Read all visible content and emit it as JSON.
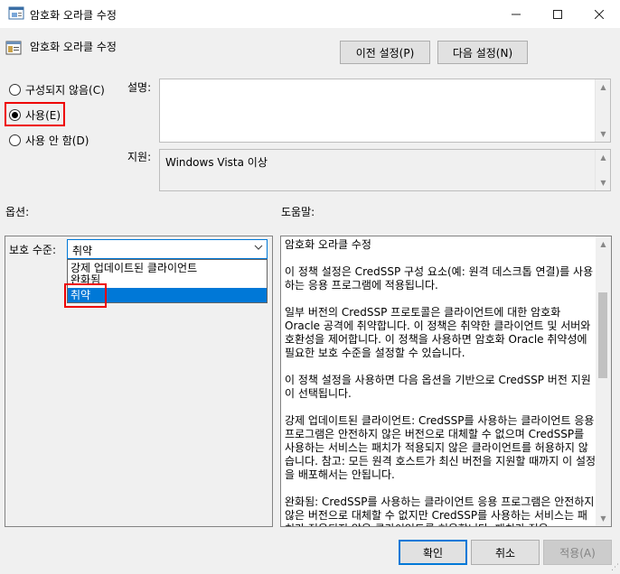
{
  "window": {
    "title": "암호화 오라클 수정"
  },
  "header": {
    "title": "암호화 오라클 수정"
  },
  "nav": {
    "prev_label": "이전 설정(P)",
    "next_label": "다음 설정(N)"
  },
  "state": {
    "not_configured_label": "구성되지 않음(C)",
    "enabled_label": "사용(E)",
    "disabled_label": "사용 안 함(D)",
    "selected": "enabled"
  },
  "comment": {
    "label": "설명:",
    "value": ""
  },
  "supported": {
    "label": "지원:",
    "value": "Windows Vista 이상"
  },
  "options": {
    "section_label": "옵션:",
    "protection_label": "보호 수준:",
    "selected_value": "취약",
    "dropdown_options": [
      "강제 업데이트된 클라이언트",
      "완화됨",
      "취약"
    ]
  },
  "help": {
    "section_label": "도움말:",
    "title": "암호화 오라클 수정",
    "paragraphs": [
      "이 정책 설정은 CredSSP 구성 요소(예: 원격 데스크톱 연결)를 사용하는 응용 프로그램에 적용됩니다.",
      "일부 버전의 CredSSP 프로토콜은 클라이언트에 대한 암호화 Oracle 공격에 취약합니다.  이 정책은 취약한 클라이언트 및 서버와 호환성을 제어합니다.  이 정책을 사용하면 암호화 Oracle 취약성에 필요한 보호 수준을 설정할 수 있습니다.",
      "이 정책 설정을 사용하면 다음 옵션을 기반으로 CredSSP 버전 지원이 선택됩니다.",
      "강제 업데이트된 클라이언트: CredSSP를 사용하는 클라이언트 응용 프로그램은 안전하지 않은 버전으로 대체할 수 없으며 CredSSP를 사용하는 서비스는 패치가 적용되지 않은 클라이언트를 허용하지 않습니다. 참고: 모든 원격 호스트가 최신 버전을 지원할 때까지 이 설정을 배포해서는 안됩니다.",
      "완화됨: CredSSP를 사용하는 클라이언트 응용 프로그램은 안전하지 않은 버전으로 대체할 수 없지만 CredSSP를 사용하는 서비스는 패치가 적용되지 않은 클라이언트를 허용합니다. 패치가 적용"
    ]
  },
  "footer": {
    "ok_label": "확인",
    "cancel_label": "취소",
    "apply_label": "적용(A)"
  }
}
